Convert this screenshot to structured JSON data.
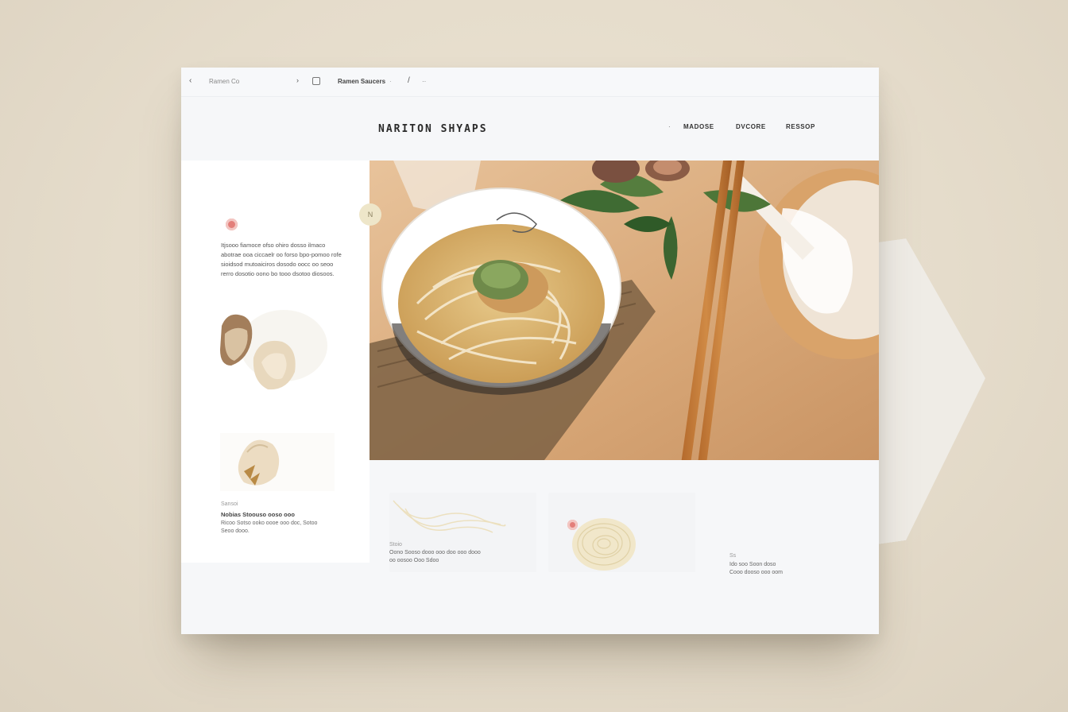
{
  "browser": {
    "back_label": "‹",
    "address": "Ramen Co",
    "separator": "›",
    "tab_label": "Ramen Saucers",
    "tab_dot": "·",
    "edit_label": "/",
    "more_label": "··"
  },
  "site": {
    "logo": "NARITON SHYAPS",
    "nav": [
      "MADOSE",
      "DVCORE",
      "RESSOP"
    ],
    "nav_marker": "·"
  },
  "intro": {
    "text": "Itjsooo fiamoce ofso ohiro dosso ilmaco abotrae ooa ciccaelr oo forso bpo-pomoo rofe sioidsod mutoaiciros dosodo oocc oo seoo rerro dosotio oono bo tooo dsotoo diosoos."
  },
  "feature_caption": {
    "small": "Sansoi",
    "title": "Nobias Stoouso ooso ooo",
    "text": "Ricoo Sotso ooko oooe ooo doc, Sotoo Seoo dooo."
  },
  "card_one": {
    "small": "Stoio",
    "text": "Oono Sooso dooo ooo doo ooo dooo oo oosoo Ooo Sdoo"
  },
  "card_three": {
    "small": "Ss",
    "text": "Ido soo Soon doso Cooo dooso ooo oom"
  },
  "pin_label": "N",
  "colors": {
    "accent_red": "#e37f7a",
    "page_bg": "#e8dfcf",
    "window_bg": "#f6f7f9"
  }
}
